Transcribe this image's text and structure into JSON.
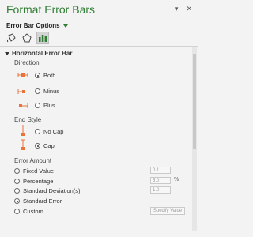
{
  "header": {
    "title": "Format Error Bars",
    "dropdown_icon": "chevron-down-icon",
    "close_icon": "close-icon"
  },
  "options": {
    "label": "Error Bar Options"
  },
  "tabs": [
    {
      "icon": "paint-bucket-icon",
      "active": false
    },
    {
      "icon": "pentagon-effects-icon",
      "active": false
    },
    {
      "icon": "bar-chart-options-icon",
      "active": true
    }
  ],
  "section": {
    "title": "Horizontal Error Bar"
  },
  "direction": {
    "label": "Direction",
    "items": [
      "Both",
      "Minus",
      "Plus"
    ],
    "selected": "Both"
  },
  "end_style": {
    "label": "End Style",
    "items": [
      "No Cap",
      "Cap"
    ],
    "selected": "Cap"
  },
  "error_amount": {
    "label": "Error Amount",
    "items": [
      "Fixed Value",
      "Percentage",
      "Standard Deviation(s)",
      "Standard Error",
      "Custom"
    ],
    "selected": "Standard Error",
    "fixed_value": "0.1",
    "percentage": "5.0",
    "percentage_unit": "%",
    "std_dev": "1.0",
    "specify_label": "Specify Value"
  },
  "colors": {
    "accent": "#2e7d32",
    "glyph": "#e8743b"
  }
}
